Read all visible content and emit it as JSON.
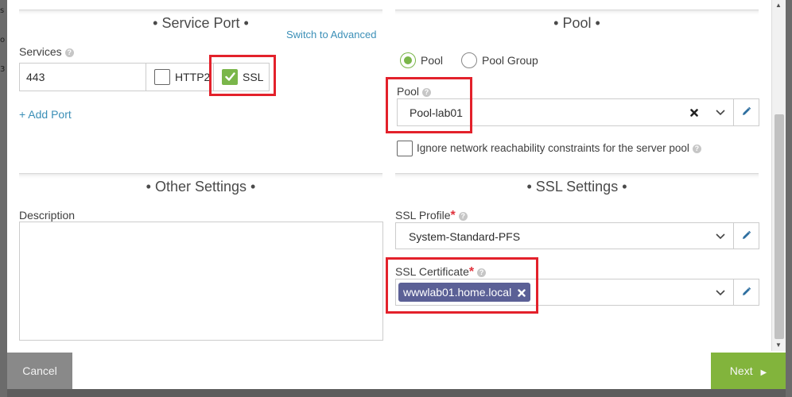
{
  "background": {
    "letters": [
      "s",
      "o",
      "3"
    ]
  },
  "service_port": {
    "title": "• Service Port •",
    "switch_link": "Switch to Advanced",
    "services_label": "Services",
    "port_value": "443",
    "http2_label": "HTTP2",
    "http2_checked": false,
    "ssl_label": "SSL",
    "ssl_checked": true,
    "add_port_link": "+ Add Port"
  },
  "pool": {
    "title": "• Pool •",
    "radio_pool": "Pool",
    "radio_pool_group": "Pool Group",
    "selected": "Pool",
    "pool_label": "Pool",
    "pool_value": "Pool-lab01",
    "ignore_label": "Ignore network reachability constraints for the server pool",
    "ignore_checked": false
  },
  "other_settings": {
    "title": "• Other Settings •",
    "description_label": "Description",
    "description_value": ""
  },
  "ssl_settings": {
    "title": "• SSL Settings •",
    "profile_label": "SSL Profile",
    "profile_value": "System-Standard-PFS",
    "certificate_label": "SSL Certificate",
    "certificate_tag": "wwwlab01.home.local",
    "required_mark": "*"
  },
  "footer": {
    "cancel_label": "Cancel",
    "next_label": "Next"
  },
  "colors": {
    "accent_green": "#7ab64a",
    "link_blue": "#3b8fb7",
    "highlight_red": "#e3212b",
    "tag_purple": "#5b6096"
  }
}
